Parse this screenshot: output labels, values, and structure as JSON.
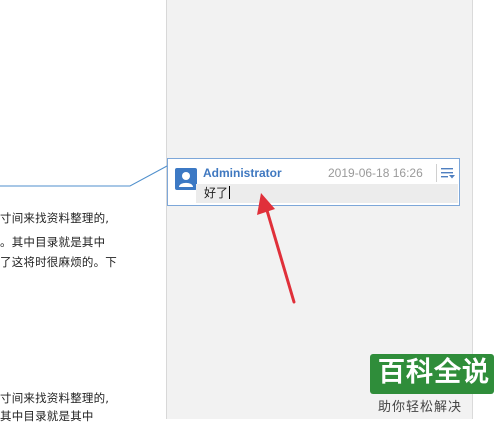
{
  "document": {
    "lines_block1": [
      "寸间来找资料整理的,",
      "。其中目录就是其中",
      "了这将时很麻烦的。下"
    ],
    "lines_block2": [
      "寸间来找资料整理的,",
      "其中目录就是其中"
    ]
  },
  "comment": {
    "author": "Administrator",
    "timestamp": "2019-06-18 16:26",
    "text": "好了",
    "avatar_icon": "user-icon",
    "menu_icon": "list-menu-icon"
  },
  "annotation_arrow": {
    "color": "#e0303a"
  },
  "watermark": {
    "title": "百科全说",
    "subtitle": "助你轻松解决",
    "badge_color": "#2f8d3a"
  }
}
